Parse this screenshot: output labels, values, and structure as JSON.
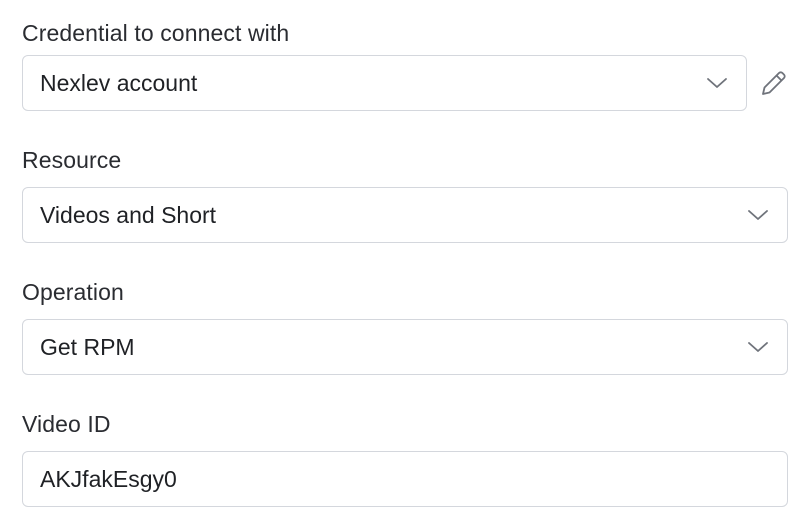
{
  "credential": {
    "label": "Credential to connect with",
    "value": "Nexlev account",
    "edit_icon": "pencil-icon",
    "dropdown_icon": "chevron-down-icon"
  },
  "resource": {
    "label": "Resource",
    "value": "Videos and Short",
    "dropdown_icon": "chevron-down-icon"
  },
  "operation": {
    "label": "Operation",
    "value": "Get RPM",
    "dropdown_icon": "chevron-down-icon"
  },
  "video_id": {
    "label": "Video ID",
    "value": "AKJfakEsgy0"
  },
  "colors": {
    "border": "#d4d7dd",
    "text": "#1f2125",
    "icon": "#6f737b"
  }
}
